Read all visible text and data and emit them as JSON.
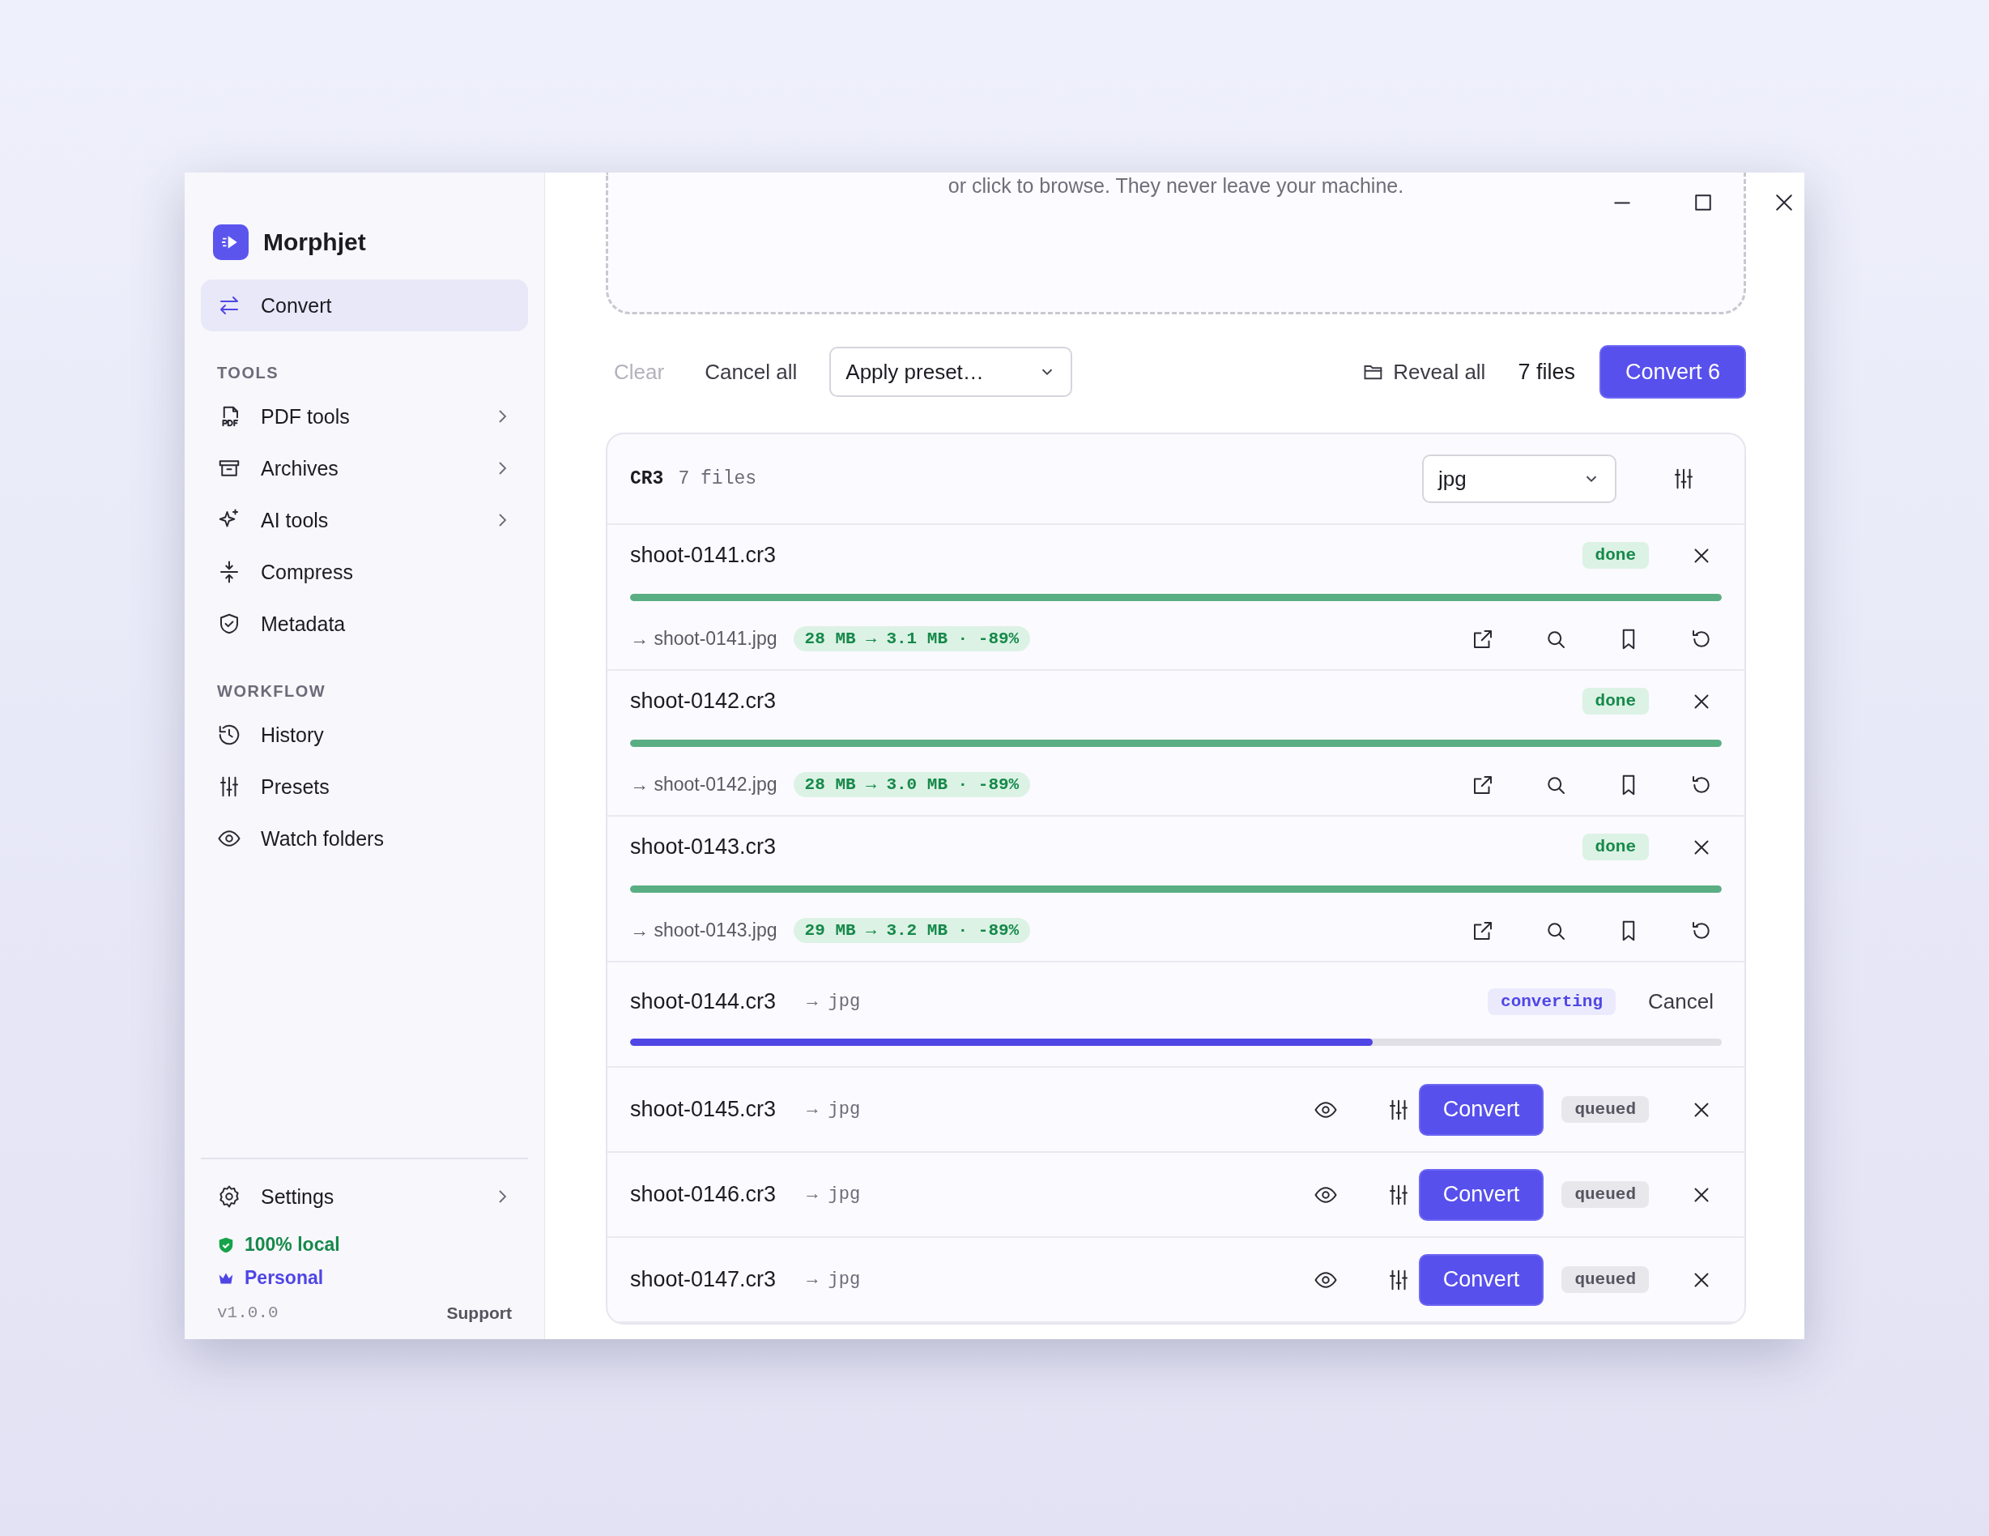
{
  "app": {
    "name": "Morphjet"
  },
  "sidebar": {
    "primary": {
      "label": "Convert",
      "selected": true
    },
    "sections": [
      {
        "title": "TOOLS",
        "items": [
          {
            "label": "PDF tools",
            "submenu": true
          },
          {
            "label": "Archives",
            "submenu": true
          },
          {
            "label": "AI tools",
            "submenu": true
          },
          {
            "label": "Compress",
            "submenu": false
          },
          {
            "label": "Metadata",
            "submenu": false
          }
        ]
      },
      {
        "title": "WORKFLOW",
        "items": [
          {
            "label": "History",
            "submenu": false
          },
          {
            "label": "Presets",
            "submenu": false
          },
          {
            "label": "Watch folders",
            "submenu": false
          }
        ]
      }
    ],
    "settings": {
      "label": "Settings"
    },
    "local_badge": "100% local",
    "plan": "Personal",
    "version": "v1.0.0",
    "support": "Support"
  },
  "dropzone": {
    "hint": "or click to browse. They never leave your machine."
  },
  "toolbar": {
    "clear": {
      "label": "Clear",
      "disabled": true
    },
    "cancel_all": "Cancel all",
    "preset": {
      "placeholder": "Apply preset…"
    },
    "reveal_all": "Reveal all",
    "file_count": "7 files",
    "convert": "Convert 6"
  },
  "group": {
    "format": "CR3",
    "count": "7 files",
    "target": "jpg"
  },
  "files": [
    {
      "kind": "done",
      "name": "shoot-0141.cr3",
      "status": "done",
      "output": "→ shoot-0141.jpg",
      "stats": "28 MB → 3.1 MB · -89%",
      "level": 1
    },
    {
      "kind": "done",
      "name": "shoot-0142.cr3",
      "status": "done",
      "output": "→ shoot-0142.jpg",
      "stats": "28 MB → 3.0 MB · -89%",
      "level": 1
    },
    {
      "kind": "done",
      "name": "shoot-0143.cr3",
      "status": "done",
      "output": "→ shoot-0143.jpg",
      "stats": "29 MB → 3.2 MB · -89%",
      "level": 1
    },
    {
      "kind": "converting",
      "name": "shoot-0144.cr3",
      "target": "→ jpg",
      "status": "converting",
      "action": "Cancel",
      "level": 0.68
    },
    {
      "kind": "queued",
      "name": "shoot-0145.cr3",
      "target": "→ jpg",
      "button": "Convert",
      "status": "queued"
    },
    {
      "kind": "queued",
      "name": "shoot-0146.cr3",
      "target": "→ jpg",
      "button": "Convert",
      "status": "queued"
    },
    {
      "kind": "queued",
      "name": "shoot-0147.cr3",
      "target": "→ jpg",
      "button": "Convert",
      "status": "queued"
    }
  ]
}
